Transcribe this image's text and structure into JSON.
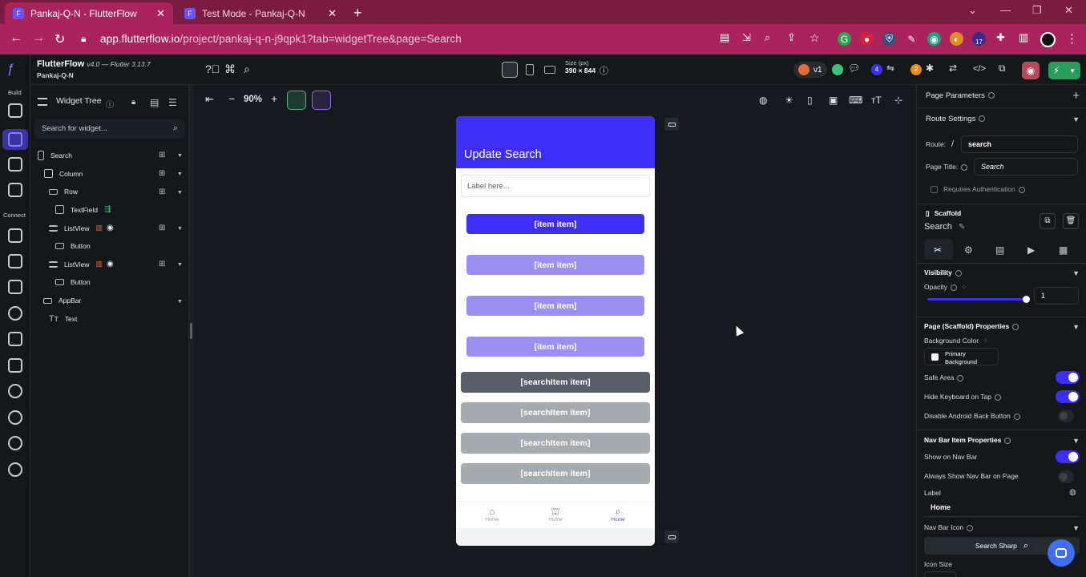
{
  "browser": {
    "tabs": [
      {
        "title": "Pankaj-Q-N - FlutterFlow",
        "active": true
      },
      {
        "title": "Test Mode - Pankaj-Q-N",
        "active": false
      }
    ],
    "url_host": "app.flutterflow.io",
    "url_path": "/project/pankaj-q-n-j9qpk1?tab=widgetTree&page=Search",
    "extension_badge": "17",
    "colors": {
      "tabbar": "#7a1c3f",
      "toolbar": "#a8245a"
    }
  },
  "app": {
    "brand": "FlutterFlow",
    "version": "v4.0 — Flutter 3.13.7",
    "project": "Pankaj-Q-N",
    "rail": {
      "build_label": "Build",
      "connect_label": "Connect"
    },
    "device_size_label": "Size (px)",
    "device_size_value": "390 × 844",
    "version_pill": "v1",
    "badge_blue": "4",
    "badge_orange": "2",
    "accent": "#3d2ef5"
  },
  "widget_tree": {
    "title": "Widget Tree",
    "search_placeholder": "Search for widget...",
    "nodes": [
      {
        "label": "Search",
        "icon": "phone-icon"
      },
      {
        "label": "Column",
        "icon": "column-icon"
      },
      {
        "label": "Row",
        "icon": "row-icon"
      },
      {
        "label": "TextField",
        "icon": "textfield-icon"
      },
      {
        "label": "ListView",
        "icon": "listview-icon"
      },
      {
        "label": "Button",
        "icon": "button-icon"
      },
      {
        "label": "ListView",
        "icon": "listview-icon"
      },
      {
        "label": "Button",
        "icon": "button-icon"
      },
      {
        "label": "AppBar",
        "icon": "appbar-icon"
      },
      {
        "label": "Text",
        "icon": "text-icon"
      }
    ]
  },
  "canvas": {
    "zoom": "90%",
    "phone": {
      "appbar_title": "Update Search",
      "textfield_placeholder": "Label here...",
      "item_buttons": [
        "[item item]",
        "[item item]",
        "[item item]",
        "[item item]"
      ],
      "search_buttons": [
        "[searchItem item]",
        "[searchItem item]",
        "[searchItem item]",
        "[searchItem item]"
      ],
      "nav_items": [
        {
          "label": "Home",
          "icon": "home-icon"
        },
        {
          "label": "Home",
          "icon": "android-icon"
        },
        {
          "label": "Home",
          "icon": "search-icon"
        }
      ]
    }
  },
  "properties": {
    "page_parameters": "Page Parameters",
    "route_settings": "Route Settings",
    "route_label": "Route:",
    "route_slash": "/",
    "route_value": "search",
    "page_title_label": "Page Title:",
    "page_title_value": "Search",
    "requires_auth": "Requires Authentication",
    "scaffold_label": "Scaffold",
    "scaffold_name": "Search",
    "visibility": "Visibility",
    "opacity_label": "Opacity",
    "opacity_value": "1",
    "page_props": "Page (Scaffold) Properties",
    "bg_color_label": "Background Color",
    "bg_color_value_1": "Primary",
    "bg_color_value_2": "Background",
    "safe_area": "Safe Area",
    "hide_keyboard": "Hide Keyboard on Tap",
    "disable_back": "Disable Android Back Button",
    "nav_bar_props": "Nav Bar Item Properties",
    "show_on_nav": "Show on Nav Bar",
    "always_show_nav": "Always Show Nav Bar on Page",
    "label_label": "Label",
    "label_value": "Home",
    "nav_icon_label": "Nav Bar Icon",
    "nav_icon_value": "Search Sharp",
    "icon_size_label": "Icon Size"
  }
}
